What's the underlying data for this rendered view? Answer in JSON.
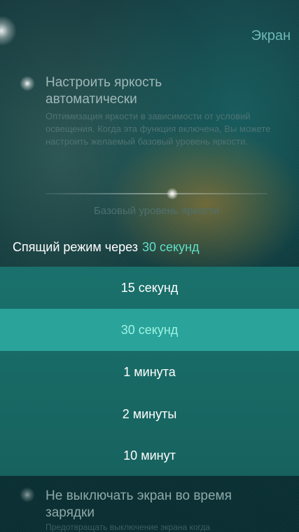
{
  "header": {
    "title": "Экран"
  },
  "auto_brightness": {
    "title": "Настроить яркость автоматически",
    "description": "Оптимизация яркости в зависимости от условий освещения. Когда эта функция включена, Вы можете настроить желаемый базовый уровень яркости.",
    "enabled": true
  },
  "brightness_slider": {
    "caption": "Базовый уровень яркости",
    "level": 0.57
  },
  "sleep": {
    "label": "Спящий режим через",
    "value": "30 секунд"
  },
  "sleep_options": [
    {
      "label": "15 секунд",
      "selected": false
    },
    {
      "label": "30 секунд",
      "selected": true
    },
    {
      "label": "1 минута",
      "selected": false
    },
    {
      "label": "2 минуты",
      "selected": false
    },
    {
      "label": "10 минут",
      "selected": false
    }
  ],
  "keep_screen_on": {
    "title": "Не выключать экран во время зарядки",
    "description": "Предотвращать выключение экрана когда"
  },
  "colors": {
    "accent": "#5ee0c8",
    "panel": "#1a716c",
    "selected_row": "#2aa39a"
  }
}
